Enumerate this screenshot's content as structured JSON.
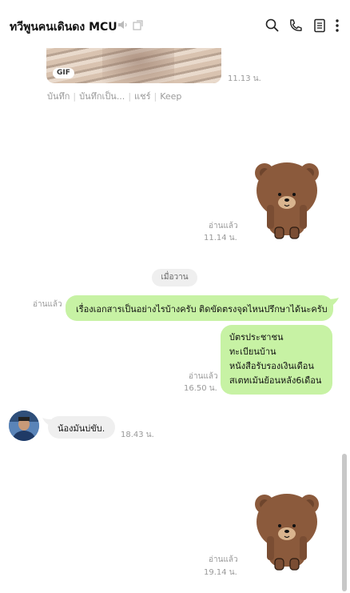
{
  "header": {
    "title": "ทวีพูนคนเดินดง MCU",
    "icons": [
      "speaker-icon",
      "external-window-icon",
      "search-icon",
      "phone-icon",
      "notes-icon",
      "more-vertical-icon"
    ]
  },
  "messages": {
    "gif": {
      "badge": "GIF",
      "time": "11.13 น.",
      "actions": [
        "บันทึก",
        "บันทึกเป็น...",
        "แชร์",
        "Keep"
      ]
    },
    "sticker1": {
      "read": "อ่านแล้ว",
      "time": "11.14 น.",
      "name": "brown-bear-sticker"
    },
    "day_separator": "เมื่อวาน",
    "outgoing1": {
      "read": "อ่านแล้ว",
      "text": "เรื่องเอกสารเป็นอย่างไรบ้างครับ ติดขัดตรงจุดไหนปรึกษาได้นะครับ"
    },
    "outgoing2": {
      "read": "อ่านแล้ว",
      "time": "16.50 น.",
      "lines": [
        "บัตรประชาชน",
        "ทะเบียนบ้าน",
        "หนังสือรับรองเงินเดือน",
        "สเตทเม้นย้อนหลัง6เดือน"
      ]
    },
    "incoming1": {
      "text": "น้องมันบ่ขับ.",
      "time": "18.43 น."
    },
    "sticker2": {
      "read": "อ่านแล้ว",
      "time": "19.14 น.",
      "name": "brown-bear-sticker"
    }
  },
  "colors": {
    "outgoing_bubble": "#c7f2a4",
    "incoming_bubble": "#efefef",
    "bear_body": "#8b5a3c"
  }
}
